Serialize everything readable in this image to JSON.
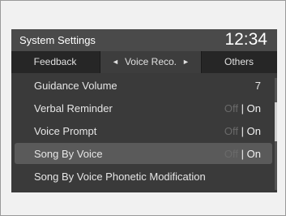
{
  "header": {
    "title": "System Settings",
    "clock": "12:34"
  },
  "tabs": [
    {
      "label": "Feedback"
    },
    {
      "label": "Voice Reco.",
      "prev_arrow": "◄",
      "next_arrow": "►",
      "selected": true
    },
    {
      "label": "Others"
    }
  ],
  "list": {
    "items": [
      {
        "label": "Guidance Volume",
        "value": "7"
      },
      {
        "label": "Verbal Reminder",
        "off": "Off",
        "sep": "|",
        "on": "On"
      },
      {
        "label": "Voice Prompt",
        "off": "Off",
        "sep": "|",
        "on": "On"
      },
      {
        "label": "Song By Voice",
        "off": "Off",
        "sep": "|",
        "on": "On",
        "selected": true
      },
      {
        "label": "Song By Voice Phonetic Modification"
      }
    ]
  },
  "colors": {
    "background": "#3a3a3a",
    "header": "#4a4a4a",
    "tab_bar": "#262626",
    "selected_row": "#5a5a5a",
    "text": "#e6e6e6",
    "inactive_option": "#6a6a6a"
  }
}
